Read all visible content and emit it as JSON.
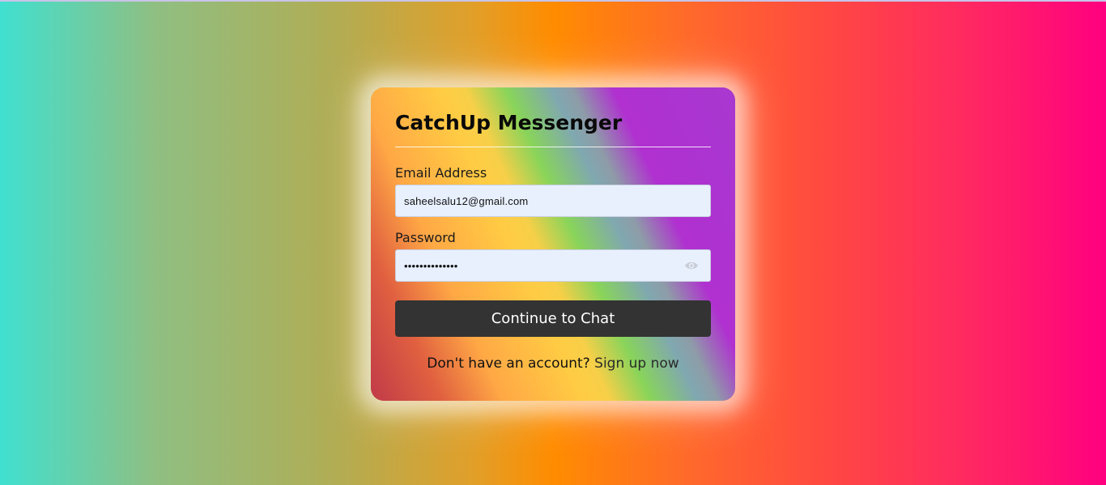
{
  "login": {
    "title": "CatchUp Messenger",
    "email_label": "Email Address",
    "email_value": "saheelsalu12@gmail.com",
    "password_label": "Password",
    "password_value": "••••••••••••••",
    "password_toggle_icon": "eye-icon",
    "submit_label": "Continue to Chat",
    "signup_prompt": "Don't have an account?",
    "signup_link": "Sign up now"
  },
  "colors": {
    "button_bg": "#333333",
    "input_bg": "#e8f0fe",
    "page_gradient_start": "#40e0d0",
    "page_gradient_mid": "#ff8c00",
    "page_gradient_end": "#ff0080"
  }
}
